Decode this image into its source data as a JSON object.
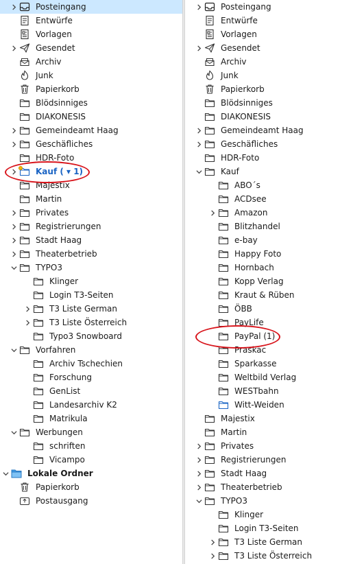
{
  "left_tree": [
    {
      "label": "Posteingang",
      "icon": "inbox-icon",
      "depth": 0,
      "twisty": "collapsed",
      "selected": true
    },
    {
      "label": "Entwürfe",
      "icon": "drafts-icon",
      "depth": 0,
      "twisty": "none"
    },
    {
      "label": "Vorlagen",
      "icon": "templates-icon",
      "depth": 0,
      "twisty": "none"
    },
    {
      "label": "Gesendet",
      "icon": "sent-icon",
      "depth": 0,
      "twisty": "collapsed"
    },
    {
      "label": "Archiv",
      "icon": "archive-icon",
      "depth": 0,
      "twisty": "none"
    },
    {
      "label": "Junk",
      "icon": "junk-icon",
      "depth": 0,
      "twisty": "none"
    },
    {
      "label": "Papierkorb",
      "icon": "trash-icon",
      "depth": 0,
      "twisty": "none"
    },
    {
      "label": "Blödsinniges",
      "icon": "folder-icon",
      "depth": 0,
      "twisty": "none"
    },
    {
      "label": "DIAKONESIS",
      "icon": "folder-icon",
      "depth": 0,
      "twisty": "none"
    },
    {
      "label": "Gemeindeamt Haag",
      "icon": "folder-icon",
      "depth": 0,
      "twisty": "collapsed"
    },
    {
      "label": "Geschäfliches",
      "icon": "folder-icon",
      "depth": 0,
      "twisty": "collapsed"
    },
    {
      "label": "HDR-Foto",
      "icon": "folder-icon",
      "depth": 0,
      "twisty": "none"
    },
    {
      "label": "Kauf ( ▾ 1)",
      "icon": "folder-icon",
      "depth": 0,
      "twisty": "collapsed",
      "bold": true,
      "blue": true,
      "newmail": true,
      "icon_color": "#1a64c4"
    },
    {
      "label": "Majestix",
      "icon": "folder-icon",
      "depth": 0,
      "twisty": "none"
    },
    {
      "label": "Martin",
      "icon": "folder-icon",
      "depth": 0,
      "twisty": "none"
    },
    {
      "label": "Privates",
      "icon": "folder-icon",
      "depth": 0,
      "twisty": "collapsed"
    },
    {
      "label": "Registrierungen",
      "icon": "folder-icon",
      "depth": 0,
      "twisty": "collapsed"
    },
    {
      "label": "Stadt Haag",
      "icon": "folder-icon",
      "depth": 0,
      "twisty": "collapsed"
    },
    {
      "label": "Theaterbetrieb",
      "icon": "folder-icon",
      "depth": 0,
      "twisty": "collapsed"
    },
    {
      "label": "TYPO3",
      "icon": "folder-icon",
      "depth": 0,
      "twisty": "expanded"
    },
    {
      "label": "Klinger",
      "icon": "folder-icon",
      "depth": 1,
      "twisty": "none"
    },
    {
      "label": "Login T3-Seiten",
      "icon": "folder-icon",
      "depth": 1,
      "twisty": "none"
    },
    {
      "label": "T3 Liste German",
      "icon": "folder-icon",
      "depth": 1,
      "twisty": "collapsed"
    },
    {
      "label": "T3 Liste Österreich",
      "icon": "folder-icon",
      "depth": 1,
      "twisty": "collapsed"
    },
    {
      "label": "Typo3 Snowboard",
      "icon": "folder-icon",
      "depth": 1,
      "twisty": "none"
    },
    {
      "label": "Vorfahren",
      "icon": "folder-icon",
      "depth": 0,
      "twisty": "expanded"
    },
    {
      "label": "Archiv Tschechien",
      "icon": "folder-icon",
      "depth": 1,
      "twisty": "none"
    },
    {
      "label": "Forschung",
      "icon": "folder-icon",
      "depth": 1,
      "twisty": "none"
    },
    {
      "label": "GenList",
      "icon": "folder-icon",
      "depth": 1,
      "twisty": "none"
    },
    {
      "label": "Landesarchiv K2",
      "icon": "folder-icon",
      "depth": 1,
      "twisty": "none"
    },
    {
      "label": "Matrikula",
      "icon": "folder-icon",
      "depth": 1,
      "twisty": "none"
    },
    {
      "label": "Werbungen",
      "icon": "folder-icon",
      "depth": 0,
      "twisty": "expanded"
    },
    {
      "label": "schriften",
      "icon": "folder-icon",
      "depth": 1,
      "twisty": "none"
    },
    {
      "label": "Vicampo",
      "icon": "folder-icon",
      "depth": 1,
      "twisty": "none"
    },
    {
      "label": "Lokale Ordner",
      "icon": "local-folders-icon",
      "depth": -1,
      "twisty": "expanded",
      "bold": true,
      "icon_color": "#3f9be6"
    },
    {
      "label": "Papierkorb",
      "icon": "trash-icon",
      "depth": 0,
      "twisty": "none"
    },
    {
      "label": "Postausgang",
      "icon": "outbox-icon",
      "depth": 0,
      "twisty": "none"
    }
  ],
  "right_tree": [
    {
      "label": "Posteingang",
      "icon": "inbox-icon",
      "depth": 0,
      "twisty": "collapsed"
    },
    {
      "label": "Entwürfe",
      "icon": "drafts-icon",
      "depth": 0,
      "twisty": "none"
    },
    {
      "label": "Vorlagen",
      "icon": "templates-icon",
      "depth": 0,
      "twisty": "none"
    },
    {
      "label": "Gesendet",
      "icon": "sent-icon",
      "depth": 0,
      "twisty": "collapsed"
    },
    {
      "label": "Archiv",
      "icon": "archive-icon",
      "depth": 0,
      "twisty": "none"
    },
    {
      "label": "Junk",
      "icon": "junk-icon",
      "depth": 0,
      "twisty": "none"
    },
    {
      "label": "Papierkorb",
      "icon": "trash-icon",
      "depth": 0,
      "twisty": "none"
    },
    {
      "label": "Blödsinniges",
      "icon": "folder-icon",
      "depth": 0,
      "twisty": "none"
    },
    {
      "label": "DIAKONESIS",
      "icon": "folder-icon",
      "depth": 0,
      "twisty": "none"
    },
    {
      "label": "Gemeindeamt Haag",
      "icon": "folder-icon",
      "depth": 0,
      "twisty": "collapsed"
    },
    {
      "label": "Geschäfliches",
      "icon": "folder-icon",
      "depth": 0,
      "twisty": "collapsed"
    },
    {
      "label": "HDR-Foto",
      "icon": "folder-icon",
      "depth": 0,
      "twisty": "none"
    },
    {
      "label": "Kauf",
      "icon": "folder-icon",
      "depth": 0,
      "twisty": "expanded"
    },
    {
      "label": "ABO´s",
      "icon": "folder-icon",
      "depth": 1,
      "twisty": "none"
    },
    {
      "label": "ACDsee",
      "icon": "folder-icon",
      "depth": 1,
      "twisty": "none"
    },
    {
      "label": "Amazon",
      "icon": "folder-icon",
      "depth": 1,
      "twisty": "collapsed"
    },
    {
      "label": "Blitzhandel",
      "icon": "folder-icon",
      "depth": 1,
      "twisty": "none"
    },
    {
      "label": "e-bay",
      "icon": "folder-icon",
      "depth": 1,
      "twisty": "none"
    },
    {
      "label": "Happy Foto",
      "icon": "folder-icon",
      "depth": 1,
      "twisty": "none"
    },
    {
      "label": "Hornbach",
      "icon": "folder-icon",
      "depth": 1,
      "twisty": "none"
    },
    {
      "label": "Kopp Verlag",
      "icon": "folder-icon",
      "depth": 1,
      "twisty": "none"
    },
    {
      "label": "Kraut & Rüben",
      "icon": "folder-icon",
      "depth": 1,
      "twisty": "none"
    },
    {
      "label": "ÖBB",
      "icon": "folder-icon",
      "depth": 1,
      "twisty": "none"
    },
    {
      "label": "PayLife",
      "icon": "folder-icon",
      "depth": 1,
      "twisty": "none"
    },
    {
      "label": "PayPal (1)",
      "icon": "folder-icon",
      "depth": 1,
      "twisty": "none"
    },
    {
      "label": "Praskac",
      "icon": "folder-icon",
      "depth": 1,
      "twisty": "none"
    },
    {
      "label": "Sparkasse",
      "icon": "folder-icon",
      "depth": 1,
      "twisty": "none"
    },
    {
      "label": "Weltbild Verlag",
      "icon": "folder-icon",
      "depth": 1,
      "twisty": "none"
    },
    {
      "label": "WESTbahn",
      "icon": "folder-icon",
      "depth": 1,
      "twisty": "none"
    },
    {
      "label": "Witt-Weiden",
      "icon": "folder-icon",
      "depth": 1,
      "twisty": "none",
      "icon_color": "#1a64c4"
    },
    {
      "label": "Majestix",
      "icon": "folder-icon",
      "depth": 0,
      "twisty": "none"
    },
    {
      "label": "Martin",
      "icon": "folder-icon",
      "depth": 0,
      "twisty": "none"
    },
    {
      "label": "Privates",
      "icon": "folder-icon",
      "depth": 0,
      "twisty": "collapsed"
    },
    {
      "label": "Registrierungen",
      "icon": "folder-icon",
      "depth": 0,
      "twisty": "collapsed"
    },
    {
      "label": "Stadt Haag",
      "icon": "folder-icon",
      "depth": 0,
      "twisty": "collapsed"
    },
    {
      "label": "Theaterbetrieb",
      "icon": "folder-icon",
      "depth": 0,
      "twisty": "collapsed"
    },
    {
      "label": "TYPO3",
      "icon": "folder-icon",
      "depth": 0,
      "twisty": "expanded"
    },
    {
      "label": "Klinger",
      "icon": "folder-icon",
      "depth": 1,
      "twisty": "none"
    },
    {
      "label": "Login T3-Seiten",
      "icon": "folder-icon",
      "depth": 1,
      "twisty": "none"
    },
    {
      "label": "T3 Liste German",
      "icon": "folder-icon",
      "depth": 1,
      "twisty": "collapsed"
    },
    {
      "label": "T3 Liste Österreich",
      "icon": "folder-icon",
      "depth": 1,
      "twisty": "collapsed"
    }
  ],
  "colors": {
    "selected_bg": "#cce8ff",
    "annotation": "#d8141b",
    "unread": "#1a64c4"
  }
}
